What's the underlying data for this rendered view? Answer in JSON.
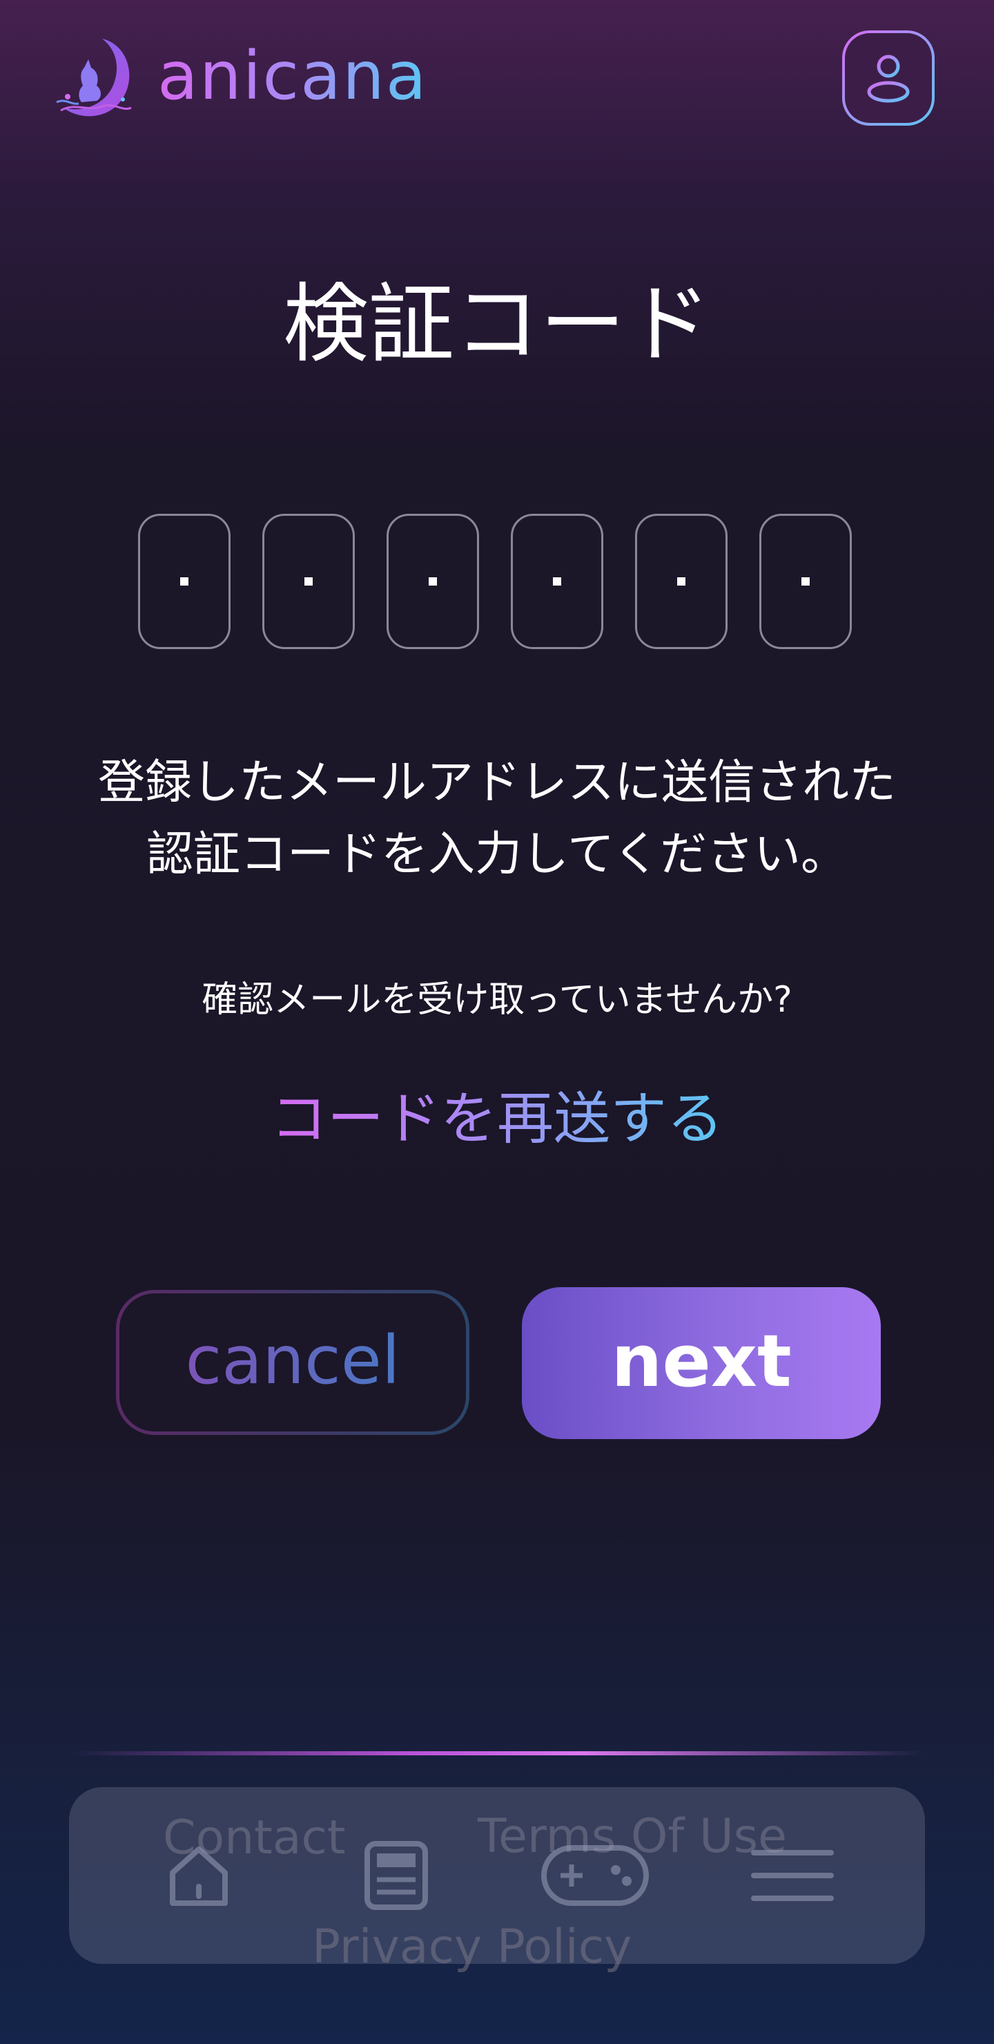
{
  "header": {
    "brand": "anicana",
    "logo_icon": "crescent-moon-cat-logo",
    "account_icon": "user-icon"
  },
  "page": {
    "title": "検証コード",
    "code_length": 6,
    "code_placeholder": "·",
    "instruction_line1": "登録したメールアドレスに送信された",
    "instruction_line2": "認証コードを入力してください。",
    "question": "確認メールを受け取っていませんか?",
    "resend_link": "コードを再送する"
  },
  "buttons": {
    "cancel": "cancel",
    "next": "next"
  },
  "footer": {
    "links": {
      "contact": "Contact",
      "terms": "Terms Of Use",
      "privacy": "Privacy Policy"
    }
  },
  "nav": {
    "items": [
      {
        "icon": "home-icon"
      },
      {
        "icon": "news-icon"
      },
      {
        "icon": "gamepad-icon"
      },
      {
        "icon": "menu-icon"
      }
    ]
  },
  "colors": {
    "accent_pink": "#d56bf0",
    "accent_purple": "#a98af5",
    "accent_cyan": "#5cc6f2",
    "next_button": "#8f6ce0",
    "background": "#1a1628"
  }
}
